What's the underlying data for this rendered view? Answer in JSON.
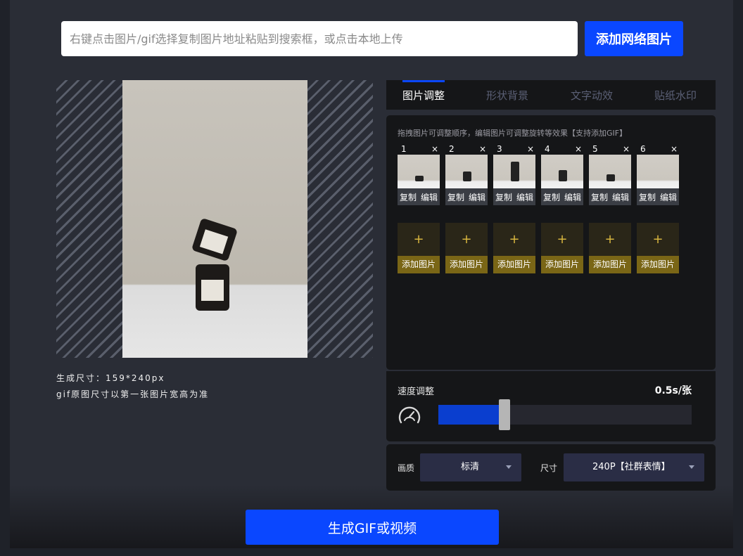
{
  "search": {
    "placeholder": "右键点击图片/gif选择复制图片地址粘贴到搜索框，或点击本地上传",
    "add_button": "添加网络图片"
  },
  "preview": {
    "size_text": "生成尺寸：159*240px",
    "note_text": "gif原图尺寸以第一张图片宽高为准"
  },
  "tabs": [
    {
      "label": "图片调整",
      "active": true
    },
    {
      "label": "形状背景",
      "active": false
    },
    {
      "label": "文字动效",
      "active": false
    },
    {
      "label": "贴纸水印",
      "active": false
    }
  ],
  "frames": {
    "hint": "拖拽图片可调整顺序，编辑图片可调整旋转等效果【支持添加GIF】",
    "items": [
      {
        "num": "1",
        "close": "×",
        "copy": "复制",
        "edit": "编辑"
      },
      {
        "num": "2",
        "close": "×",
        "copy": "复制",
        "edit": "编辑"
      },
      {
        "num": "3",
        "close": "×",
        "copy": "复制",
        "edit": "编辑"
      },
      {
        "num": "4",
        "close": "×",
        "copy": "复制",
        "edit": "编辑"
      },
      {
        "num": "5",
        "close": "×",
        "copy": "复制",
        "edit": "编辑"
      },
      {
        "num": "6",
        "close": "×",
        "copy": "复制",
        "edit": "编辑"
      }
    ],
    "add_slots": [
      {
        "plus": "+",
        "label": "添加图片"
      },
      {
        "plus": "+",
        "label": "添加图片"
      },
      {
        "plus": "+",
        "label": "添加图片"
      },
      {
        "plus": "+",
        "label": "添加图片"
      },
      {
        "plus": "+",
        "label": "添加图片"
      },
      {
        "plus": "+",
        "label": "添加图片"
      }
    ]
  },
  "speed": {
    "title": "速度调整",
    "value": "0.5s/张",
    "slider_fraction": 0.24,
    "icon": "speedometer-icon"
  },
  "options": {
    "quality_label": "画质",
    "quality_value": "标清",
    "size_label": "尺寸",
    "size_value": "240P【社群表情】"
  },
  "generate_button": "生成GIF或视频",
  "colors": {
    "accent": "#0a47ff",
    "add_slot": "#7a6616",
    "background": "#2a2d36"
  }
}
